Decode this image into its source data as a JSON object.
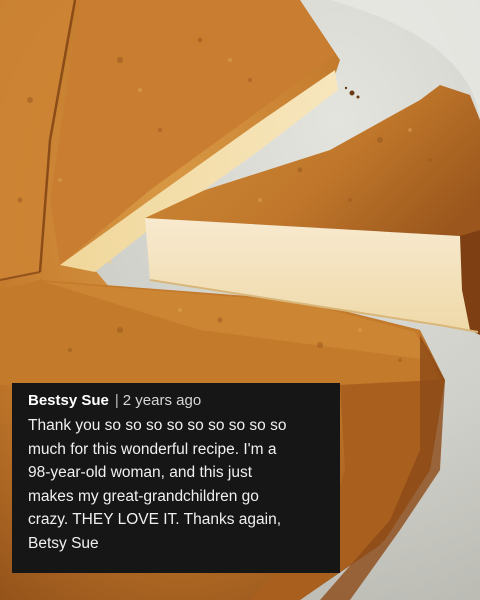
{
  "comment": {
    "author": "Bestsy Sue",
    "separator": "|",
    "timestamp": "2 years ago",
    "body_lines": [
      "Thank you so so so so so so so so so",
      "much for this wonderful recipe. I'm a",
      "98-year-old woman, and this just",
      "makes my great-grandchildren go",
      "crazy. THEY LOVE IT. Thanks again,",
      "Betsy Sue"
    ]
  },
  "colors": {
    "card_background": "#161616",
    "card_text": "#f0f0f0",
    "crust": "#c9822f",
    "cake_interior": "#f4e2b3",
    "plate": "#d3d3cd"
  }
}
